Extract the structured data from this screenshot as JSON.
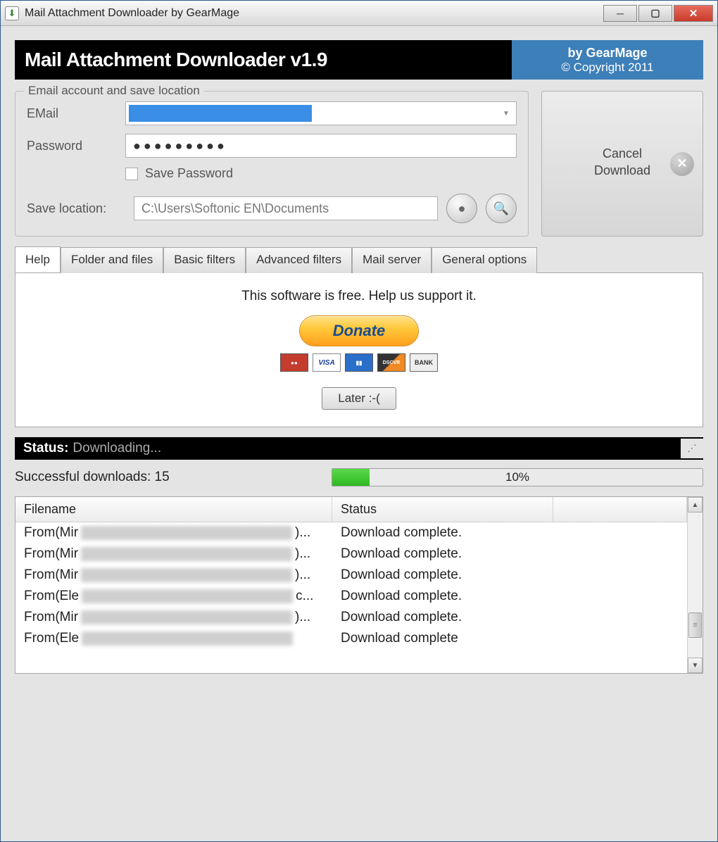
{
  "titlebar": {
    "title": "Mail Attachment Downloader by GearMage"
  },
  "banner": {
    "title": "Mail Attachment Downloader v1.9",
    "by": "by GearMage",
    "copyright": "© Copyright 2011"
  },
  "account": {
    "legend": "Email account and save location",
    "email_label": "EMail",
    "password_label": "Password",
    "password_value": "●●●●●●●●●",
    "save_password_label": "Save Password",
    "save_location_label": "Save location:",
    "save_location_value": "C:\\Users\\Softonic EN\\Documents"
  },
  "cancel": {
    "line1": "Cancel",
    "line2": "Download"
  },
  "tabs": [
    "Help",
    "Folder and files",
    "Basic filters",
    "Advanced filters",
    "Mail server",
    "General options"
  ],
  "help": {
    "text": "This software is free. Help us support it.",
    "donate": "Donate",
    "later": "Later :-("
  },
  "cards": [
    "MC",
    "VISA",
    "AMEX",
    "DISC",
    "BANK"
  ],
  "status": {
    "label": "Status:",
    "text": "Downloading..."
  },
  "progress": {
    "success_label": "Successful downloads: 15",
    "percent_text": "10%",
    "percent": 10
  },
  "list": {
    "columns": [
      "Filename",
      "Status"
    ],
    "rows": [
      {
        "pre": "From(Mir",
        "suf": ")...",
        "status": "Download complete."
      },
      {
        "pre": "From(Mir",
        "suf": ")...",
        "status": "Download complete."
      },
      {
        "pre": "From(Mir",
        "suf": ")...",
        "status": "Download complete."
      },
      {
        "pre": "From(Ele",
        "suf": "c...",
        "status": "Download complete."
      },
      {
        "pre": "From(Mir",
        "suf": ")...",
        "status": "Download complete."
      },
      {
        "pre": "From(Ele",
        "suf": "",
        "status": "Download complete"
      }
    ]
  }
}
